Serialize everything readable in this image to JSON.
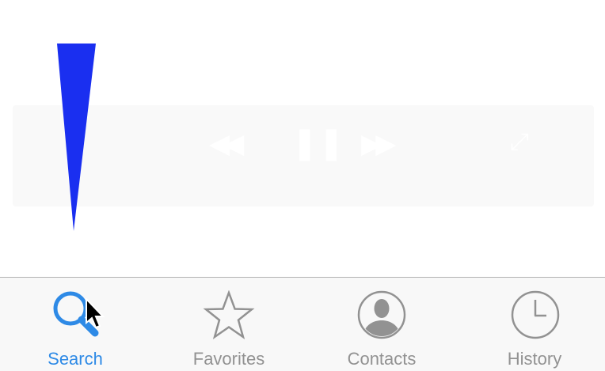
{
  "colors": {
    "accent": "#2e8ae6",
    "inactive": "#929292",
    "marker": "#1a2ff0",
    "tabbar_bg": "#f8f8f8"
  },
  "tabbar": {
    "tabs": [
      {
        "label": "Search",
        "icon": "search-icon",
        "active": true
      },
      {
        "label": "Favorites",
        "icon": "star-icon",
        "active": false
      },
      {
        "label": "Contacts",
        "icon": "contact-avatar-icon",
        "active": false
      },
      {
        "label": "History",
        "icon": "clock-icon",
        "active": false
      }
    ]
  }
}
